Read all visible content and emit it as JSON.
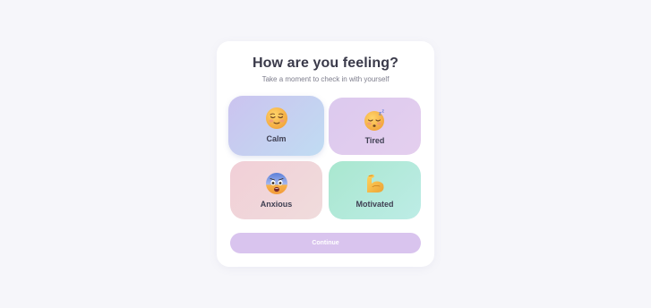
{
  "card": {
    "title": "How are you feeling?",
    "subtitle": "Take a moment to check in with yourself"
  },
  "moods": [
    {
      "label": "Calm",
      "icon": "relieved-face-icon",
      "color_from": "#cbc3ef",
      "color_to": "#c0dcf2"
    },
    {
      "label": "Tired",
      "icon": "sleeping-face-icon",
      "color_from": "#dcc9ee",
      "color_to": "#e4cfee"
    },
    {
      "label": "Anxious",
      "icon": "fearful-face-icon",
      "color_from": "#f1cfd7",
      "color_to": "#f0dcdc"
    },
    {
      "label": "Motivated",
      "icon": "flexed-biceps-icon",
      "color_from": "#a9e7cf",
      "color_to": "#bdece6"
    }
  ],
  "continue_button": {
    "label": "Continue",
    "color": "#d9c4ee"
  },
  "colors": {
    "background": "#f6f6fa",
    "card": "#ffffff",
    "text": "#3a3a4a"
  }
}
